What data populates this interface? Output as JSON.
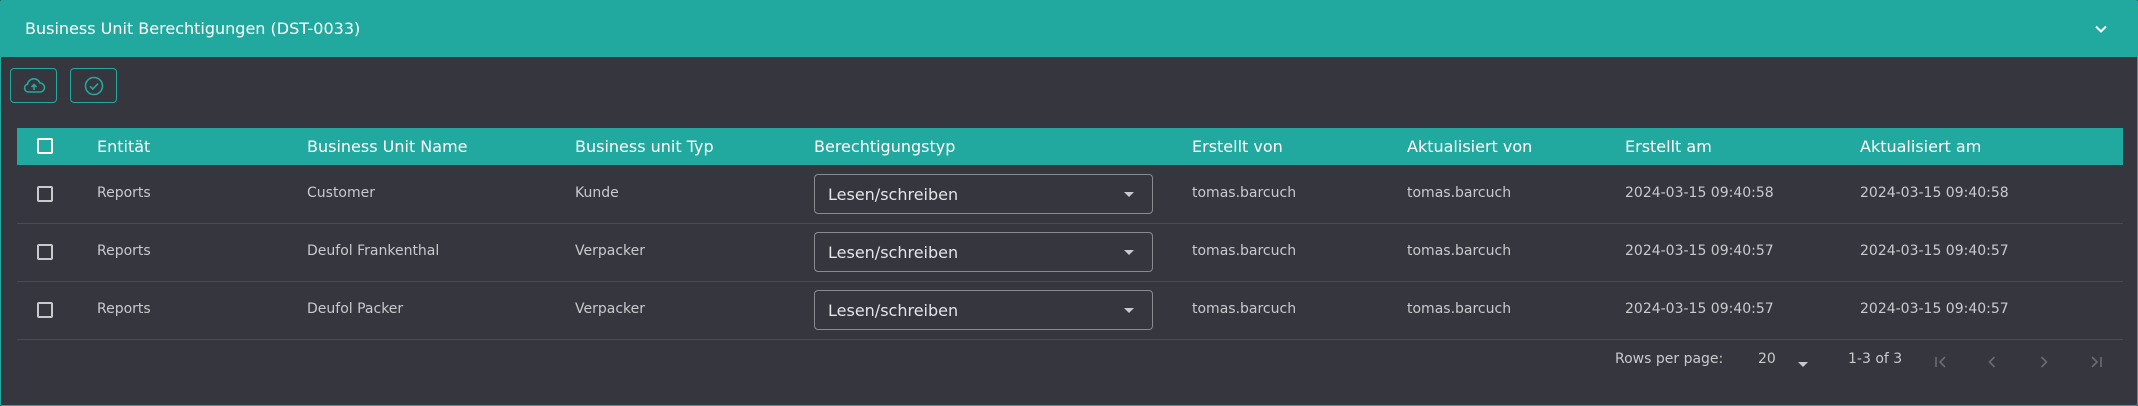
{
  "panel": {
    "title": "Business Unit Berechtigungen (DST-0033)"
  },
  "toolbar": {
    "upload_icon": "cloud-upload-icon",
    "confirm_icon": "check-circle-icon"
  },
  "table": {
    "columns": [
      "Entität",
      "Business Unit Name",
      "Business unit Typ",
      "Berechtigungstyp",
      "Erstellt von",
      "Aktualisiert von",
      "Erstellt am",
      "Aktualisiert am"
    ],
    "rows": [
      {
        "entity": "Reports",
        "bu_name": "Customer",
        "bu_type": "Kunde",
        "permission": "Lesen/schreiben",
        "created_by": "tomas.barcuch",
        "updated_by": "tomas.barcuch",
        "created_at": "2024-03-15 09:40:58",
        "updated_at": "2024-03-15 09:40:58"
      },
      {
        "entity": "Reports",
        "bu_name": "Deufol Frankenthal",
        "bu_type": "Verpacker",
        "permission": "Lesen/schreiben",
        "created_by": "tomas.barcuch",
        "updated_by": "tomas.barcuch",
        "created_at": "2024-03-15 09:40:57",
        "updated_at": "2024-03-15 09:40:57"
      },
      {
        "entity": "Reports",
        "bu_name": "Deufol Packer",
        "bu_type": "Verpacker",
        "permission": "Lesen/schreiben",
        "created_by": "tomas.barcuch",
        "updated_by": "tomas.barcuch",
        "created_at": "2024-03-15 09:40:57",
        "updated_at": "2024-03-15 09:40:57"
      }
    ]
  },
  "pagination": {
    "rows_per_page_label": "Rows per page:",
    "rows_per_page_value": "20",
    "range_label": "1-3 of 3"
  },
  "colors": {
    "accent": "#22a99f",
    "background": "#35363e"
  }
}
